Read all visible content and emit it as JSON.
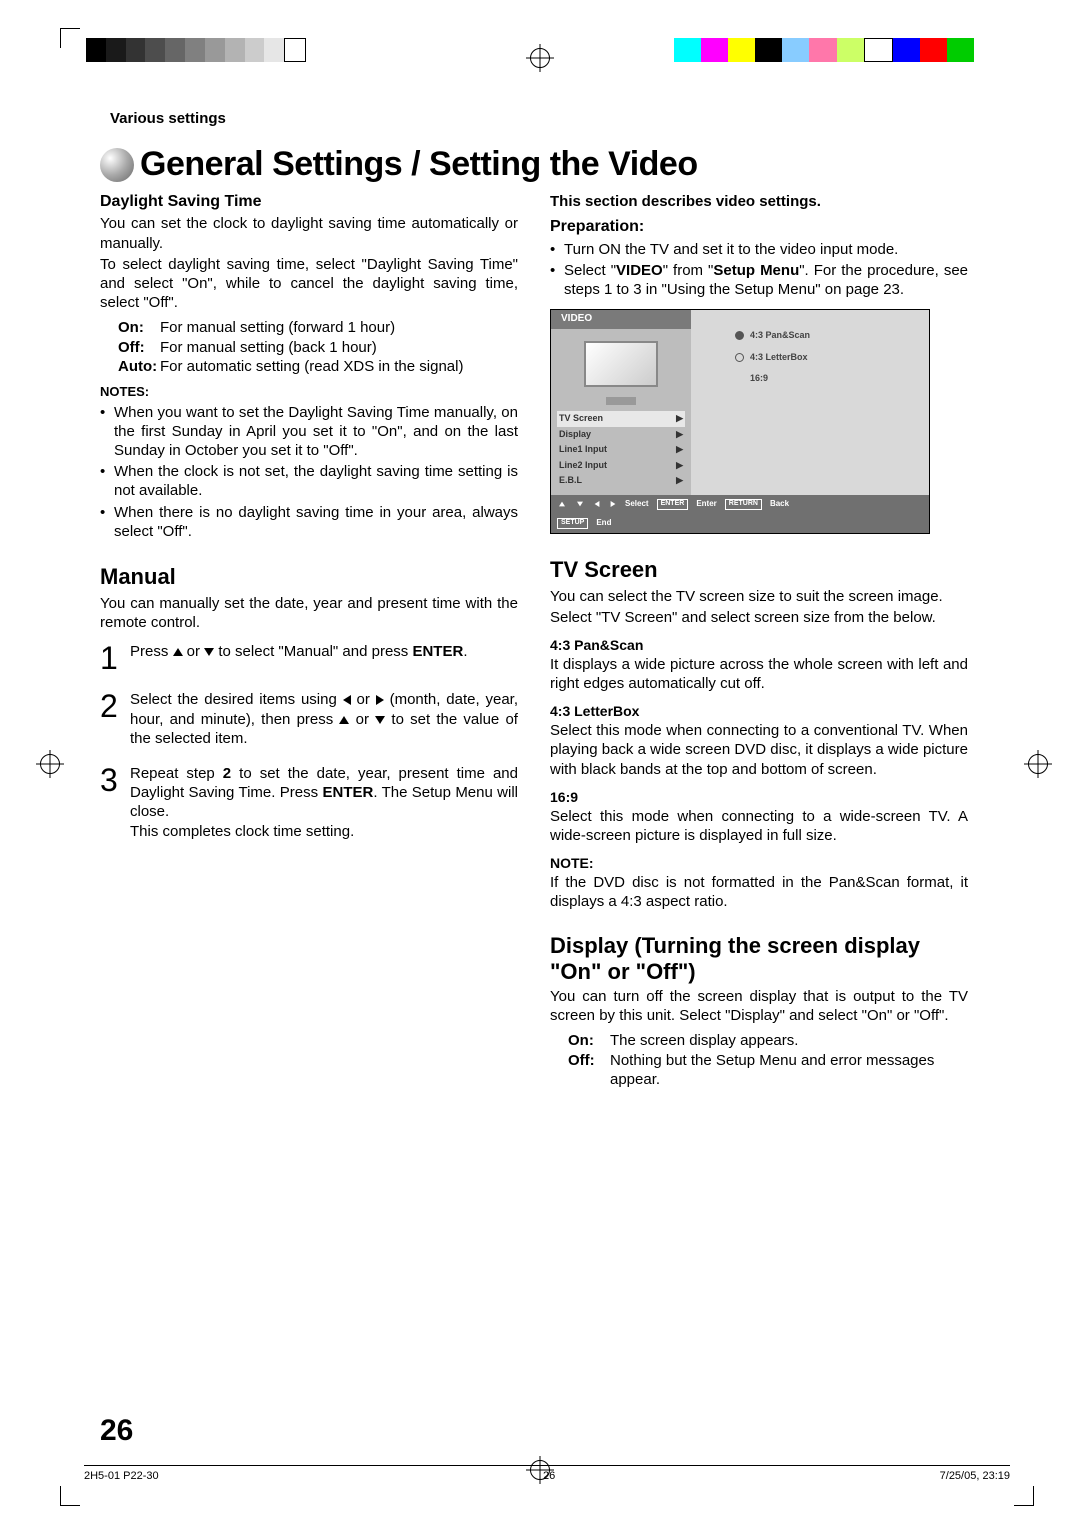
{
  "breadcrumb": "Various settings",
  "title": "General Settings / Setting the Video",
  "left": {
    "dst": {
      "heading": "Daylight Saving Time",
      "p1": "You can set the clock to daylight saving time automatically or manually.",
      "p2": "To select daylight saving time, select \"Daylight Saving Time\" and select \"On\", while to cancel the daylight saving time, select \"Off\".",
      "defs": [
        {
          "k": "On:",
          "v": "For manual setting (forward 1 hour)"
        },
        {
          "k": "Off:",
          "v": "For manual setting (back 1 hour)"
        },
        {
          "k": "Auto:",
          "v": "For automatic setting (read XDS in the signal)"
        }
      ],
      "notes_h": "NOTES:",
      "notes": [
        "When you want to set the Daylight Saving Time manually, on the first Sunday in April you set it to \"On\", and on the last Sunday in October you set it to \"Off\".",
        "When the clock is not set, the daylight saving time setting is not available.",
        "When there is no daylight saving time in your area, always select \"Off\"."
      ]
    },
    "manual": {
      "heading": "Manual",
      "intro": "You can manually set the date, year and present time with the remote control.",
      "steps": [
        {
          "n": "1",
          "a": "to select \"Manual\" and press",
          "b": "ENTER"
        },
        {
          "n": "2",
          "a": "Select the desired items using",
          "b": "(month, date, year, hour, and minute), then press",
          "c": "to set the value of the selected item."
        },
        {
          "n": "3",
          "a": "Repeat step",
          "b": "2",
          "c": "to set the date, year, present time and Daylight Saving Time. Press",
          "d": "ENTER",
          "e": ". The Setup Menu will close.",
          "f": "This completes clock time setting."
        }
      ]
    }
  },
  "right": {
    "intro": "This section describes video settings.",
    "prep": {
      "heading": "Preparation:",
      "items": [
        "Turn ON the TV and set it to the video input mode."
      ],
      "video": "VIDEO",
      "setup": "Setup Menu",
      "tail": "For the procedure, see steps 1 to 3 in \"Using the Setup Menu\" on page 23."
    },
    "menu": {
      "header": "VIDEO",
      "items": [
        "TV Screen",
        "Display",
        "Line1 Input",
        "Line2 Input",
        "E.B.L"
      ],
      "opts": [
        "4:3 Pan&Scan",
        "4:3 LetterBox",
        "16:9"
      ],
      "hints": [
        "Select",
        "ENTER",
        "Enter",
        "RETURN",
        "Back",
        "SETUP",
        "End"
      ]
    },
    "tvscreen": {
      "heading": "TV Screen",
      "p1": "You can select the TV screen size to suit the screen image.",
      "p2": "Select \"TV Screen\" and select screen size from the below.",
      "modes": [
        {
          "h": "4:3 Pan&Scan",
          "p": "It displays a wide picture across the whole screen with left and right edges automatically cut off."
        },
        {
          "h": "4:3 LetterBox",
          "p": "Select this mode when connecting to a conventional TV. When playing back a wide screen DVD disc, it displays a wide picture with black bands at the top and bottom of screen."
        },
        {
          "h": "16:9",
          "p": "Select this mode when connecting to a wide-screen TV. A wide-screen picture is displayed in full size."
        }
      ],
      "note_h": "NOTE:",
      "note": "If the DVD disc is not formatted in the Pan&Scan format, it displays a 4:3 aspect ratio."
    },
    "display": {
      "heading": "Display (Turning the screen display \"On\" or \"Off\")",
      "p": "You can turn off the screen display that is output to the TV screen by this unit. Select \"Display\" and select \"On\" or \"Off\".",
      "defs": [
        {
          "k": "On:",
          "v": "The screen display appears."
        },
        {
          "k": "Off:",
          "v": "Nothing but the Setup Menu and error messages appear."
        }
      ]
    }
  },
  "page_number": "26",
  "footer": {
    "file": "2H5-01 P22-30",
    "page": "26",
    "timestamp": "7/25/05, 23:19"
  }
}
